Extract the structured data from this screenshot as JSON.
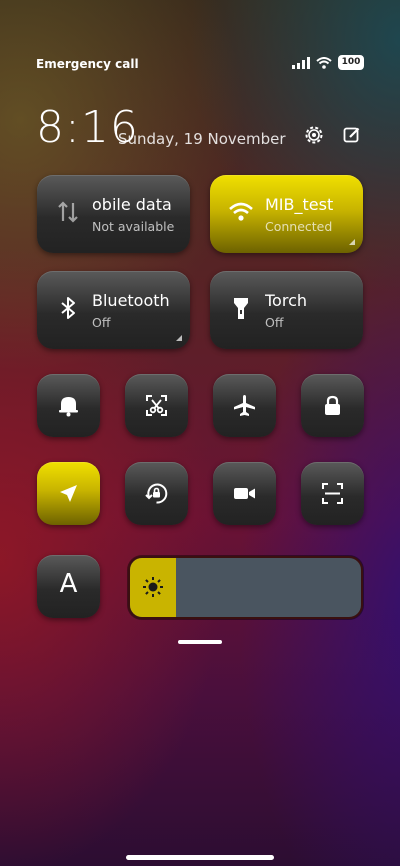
{
  "status_bar": {
    "carrier_text": "Emergency calls o",
    "battery_level": "100"
  },
  "header": {
    "time": "8:16",
    "date": "Sunday, 19 November"
  },
  "tiles": {
    "mobile_data": {
      "title": "obile data",
      "subtitle": "Not available"
    },
    "wifi": {
      "title": "MIB_test",
      "subtitle": "Connected"
    },
    "bluetooth": {
      "title": "Bluetooth",
      "subtitle": "Off"
    },
    "torch": {
      "title": "Torch",
      "subtitle": "Off"
    }
  },
  "font_size_tile": {
    "label": "A"
  },
  "brightness": {
    "level_fraction": 0.2
  },
  "colors": {
    "accent_yellow": "#e6d400",
    "tile_dark": "#2a2a2a"
  }
}
